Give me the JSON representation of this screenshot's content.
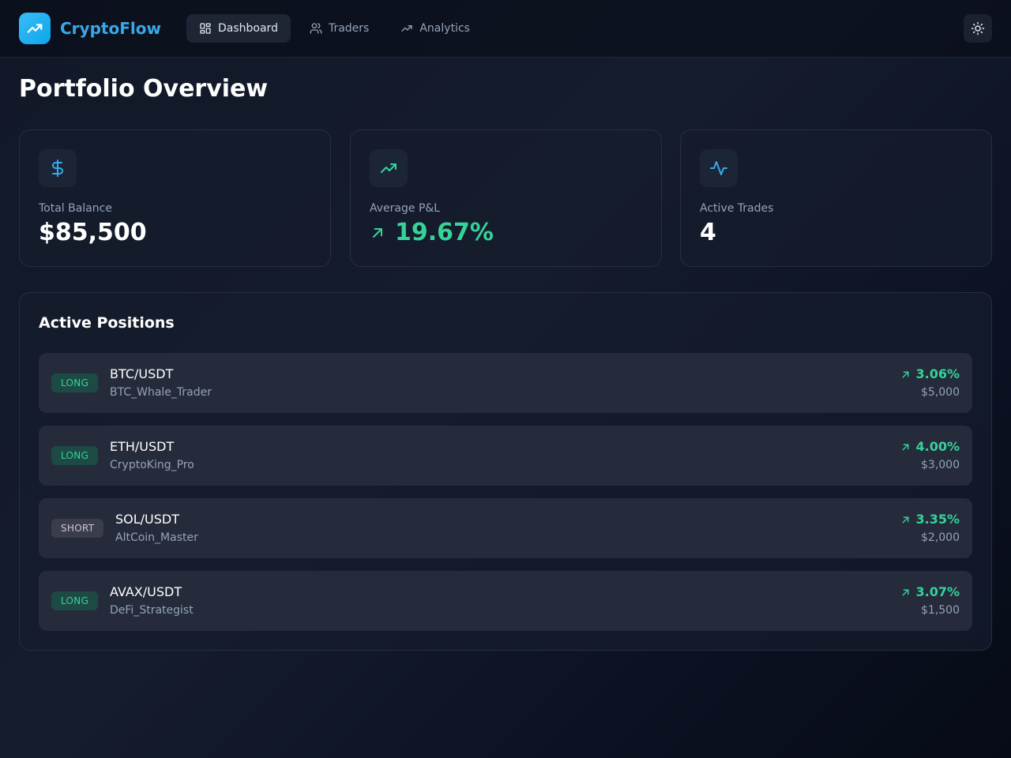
{
  "header": {
    "brand": "CryptoFlow",
    "nav": [
      {
        "label": "Dashboard",
        "icon": "grid-icon",
        "active": true
      },
      {
        "label": "Traders",
        "icon": "users-icon",
        "active": false
      },
      {
        "label": "Analytics",
        "icon": "trending-up-icon",
        "active": false
      }
    ],
    "theme_toggle_icon": "sun-icon"
  },
  "page": {
    "title": "Portfolio Overview"
  },
  "stats": [
    {
      "label": "Total Balance",
      "value": "$85,500",
      "icon": "dollar-icon"
    },
    {
      "label": "Average P&L",
      "value": "19.67%",
      "icon": "trending-up-icon",
      "trend": "up"
    },
    {
      "label": "Active Trades",
      "value": "4",
      "icon": "activity-icon"
    }
  ],
  "positions_panel": {
    "title": "Active Positions",
    "positions": [
      {
        "side": "LONG",
        "pair": "BTC/USDT",
        "trader": "BTC_Whale_Trader",
        "pnl": "3.06%",
        "amount": "$5,000"
      },
      {
        "side": "LONG",
        "pair": "ETH/USDT",
        "trader": "CryptoKing_Pro",
        "pnl": "4.00%",
        "amount": "$3,000"
      },
      {
        "side": "SHORT",
        "pair": "SOL/USDT",
        "trader": "AltCoin_Master",
        "pnl": "3.35%",
        "amount": "$2,000"
      },
      {
        "side": "LONG",
        "pair": "AVAX/USDT",
        "trader": "DeFi_Strategist",
        "pnl": "3.07%",
        "amount": "$1,500"
      }
    ]
  },
  "colors": {
    "accent": "#38bdf8",
    "positive": "#34d399",
    "background": "#0f1524"
  }
}
